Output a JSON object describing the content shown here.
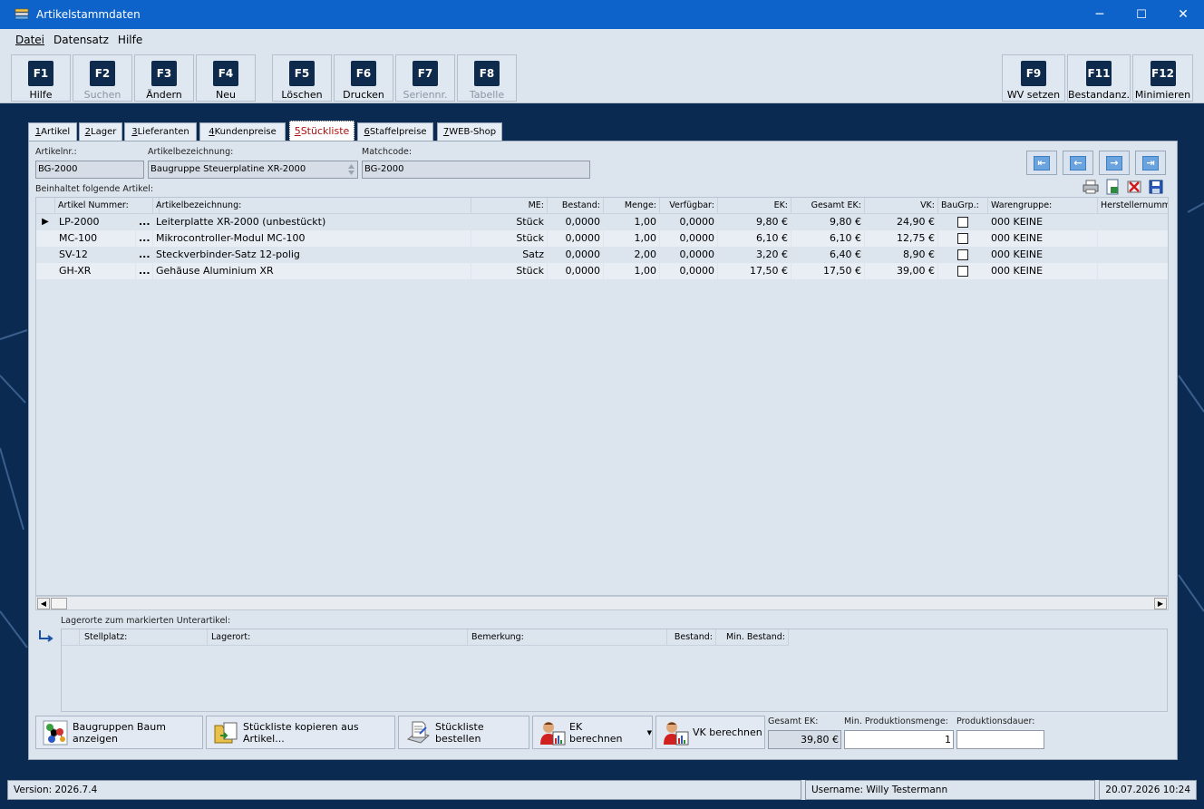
{
  "window": {
    "title": "Artikelstammdaten",
    "minimize": "─",
    "maximize": "☐",
    "close": "✕"
  },
  "menu": [
    "Datei",
    "Datensatz",
    "Hilfe"
  ],
  "fkeys": [
    {
      "key": "F1",
      "label": "Hilfe",
      "enabled": true
    },
    {
      "key": "F2",
      "label": "Suchen",
      "enabled": false
    },
    {
      "key": "F3",
      "label": "Ändern",
      "enabled": true
    },
    {
      "key": "F4",
      "label": "Neu",
      "enabled": true
    },
    {
      "key": "F5",
      "label": "Löschen",
      "enabled": true
    },
    {
      "key": "F6",
      "label": "Drucken",
      "enabled": true
    },
    {
      "key": "F7",
      "label": "Seriennr.",
      "enabled": false
    },
    {
      "key": "F8",
      "label": "Tabelle",
      "enabled": false
    },
    {
      "key": "F9",
      "label": "WV setzen",
      "enabled": true
    },
    {
      "key": "F11",
      "label": "Bestandanz.",
      "enabled": true
    },
    {
      "key": "F12",
      "label": "Minimieren",
      "enabled": true
    }
  ],
  "tabs": [
    {
      "num": "1",
      "label": " Artikel"
    },
    {
      "num": "2",
      "label": " Lager"
    },
    {
      "num": "3",
      "label": " Lieferanten"
    },
    {
      "num": "4",
      "label": " Kundenpreise"
    },
    {
      "num": "5",
      "label": " Stückliste"
    },
    {
      "num": "6",
      "label": " Staffelpreise"
    },
    {
      "num": "7",
      "label": " WEB-Shop"
    }
  ],
  "header": {
    "artikelnr_label": "Artikelnr.:",
    "artikelnr_value": "BG-2000",
    "bezeichnung_label": "Artikelbezeichnung:",
    "bezeichnung_value": "Baugruppe Steuerplatine XR-2000",
    "matchcode_label": "Matchcode:",
    "matchcode_value": "BG-2000"
  },
  "nav": {
    "first": "⇤",
    "prev": "←",
    "next": "→",
    "last": "⇥"
  },
  "bom_label": "Beinhaltet folgende Artikel:",
  "bom": {
    "columns": [
      "Artikel Nummer:",
      "Artikelbezeichnung:",
      "ME:",
      "Bestand:",
      "Menge:",
      "Verfügbar:",
      "EK:",
      "Gesamt EK:",
      "VK:",
      "BauGrp.:",
      "Warengruppe:",
      "Herstellernummer"
    ],
    "rows": [
      {
        "nr": "LP-2000",
        "more": "...",
        "bez": "Leiterplatte XR-2000 (unbestückt)",
        "me": "Stück",
        "bestand": "0,0000",
        "menge": "1,00",
        "verf": "0,0000",
        "ek": "9,80 €",
        "gek": "9,80 €",
        "vk": "24,90 €",
        "wg": "000 KEINE"
      },
      {
        "nr": "MC-100",
        "more": "...",
        "bez": "Mikrocontroller-Modul MC-100",
        "me": "Stück",
        "bestand": "0,0000",
        "menge": "1,00",
        "verf": "0,0000",
        "ek": "6,10 €",
        "gek": "6,10 €",
        "vk": "12,75 €",
        "wg": "000 KEINE"
      },
      {
        "nr": "SV-12",
        "more": "...",
        "bez": "Steckverbinder-Satz 12-polig",
        "me": "Satz",
        "bestand": "0,0000",
        "menge": "2,00",
        "verf": "0,0000",
        "ek": "3,20 €",
        "gek": "6,40 €",
        "vk": "8,90 €",
        "wg": "000 KEINE"
      },
      {
        "nr": "GH-XR",
        "more": "...",
        "bez": "Gehäuse Aluminium XR",
        "me": "Stück",
        "bestand": "0,0000",
        "menge": "1,00",
        "verf": "0,0000",
        "ek": "17,50 €",
        "gek": "17,50 €",
        "vk": "39,00 €",
        "wg": "000 KEINE"
      }
    ]
  },
  "lager": {
    "label": "Lagerorte zum markierten Unterartikel:",
    "columns": [
      "Stellplatz:",
      "Lagerort:",
      "Bemerkung:",
      "Bestand:",
      "Min. Bestand:"
    ]
  },
  "buttons": {
    "baum": "Baugruppen Baum anzeigen",
    "kopieren": "Stückliste kopieren aus Artikel...",
    "bestellen": "Stückliste bestellen",
    "ek": "EK berechnen",
    "vk": "VK berechnen"
  },
  "summary": {
    "gesamt_ek_label": "Gesamt EK:",
    "gesamt_ek_value": "39,80 €",
    "minprod_label": "Min. Produktionsmenge:",
    "minprod_value": "1",
    "dauer_label": "Produktionsdauer:",
    "dauer_value": ""
  },
  "status": {
    "version": "Version: 2026.7.4",
    "user": "Username: Willy Testermann",
    "datetime": "20.07.2026 10:24"
  }
}
